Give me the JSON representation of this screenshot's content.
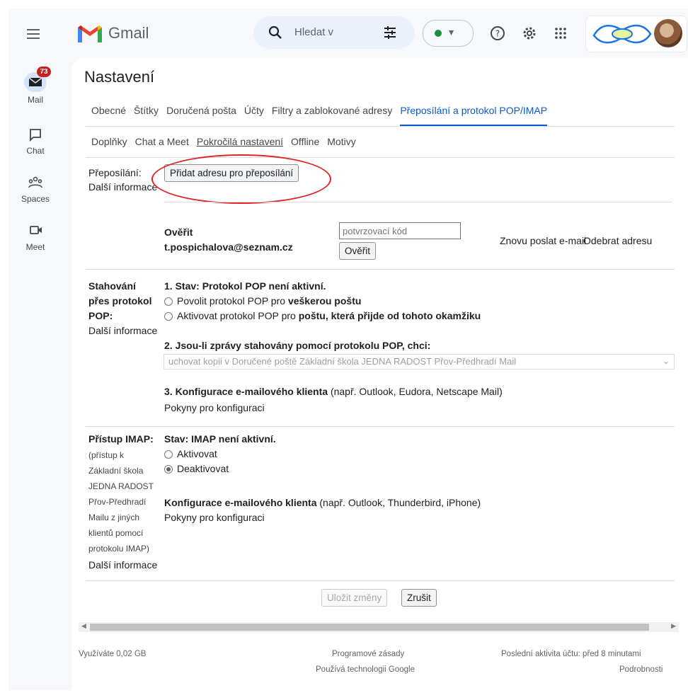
{
  "app": {
    "name": "Gmail"
  },
  "search": {
    "placeholder": "Hledat v"
  },
  "rail": {
    "mail_label": "Mail",
    "mail_badge": "73",
    "chat_label": "Chat",
    "spaces_label": "Spaces",
    "meet_label": "Meet"
  },
  "page": {
    "title": "Nastavení"
  },
  "tabs_row1": [
    "Obecné",
    "Štítky",
    "Doručená pošta",
    "Účty",
    "Filtry a zablokované adresy",
    "Přeposílání a protokol POP/IMAP"
  ],
  "tabs_row2": [
    "Doplňky",
    "Chat a Meet",
    "Pokročilá nastavení",
    "Offline",
    "Motivy"
  ],
  "forwarding": {
    "label": "Přeposílání:",
    "more_info": "Další informace",
    "add_button": "Přidat adresu pro přeposílání",
    "verify_label": "Ověřit",
    "verify_email": "t.pospichalova@seznam.cz",
    "code_placeholder": "potvrzovací kód",
    "verify_button": "Ověřit",
    "resend_link": "Znovu poslat e-mail",
    "remove_link": "Odebrat adresu"
  },
  "pop": {
    "label_line1": "Stahování",
    "label_line2": "přes protokol",
    "label_line3": "POP:",
    "more_info": "Další informace",
    "status": "1. Stav: Protokol POP není aktivní.",
    "option1_pre": "Povolit protokol POP pro ",
    "option1_bold": "veškerou poštu",
    "option2_pre": "Aktivovat protokol POP pro ",
    "option2_bold": "poštu, která přijde od tohoto okamžiku",
    "when_heading": "2. Jsou-li zprávy stahovány pomocí protokolu POP, chci:",
    "when_select": "uchovat kopii v Doručené poště Základní škola JEDNA RADOST Přov-Předhradí Mail",
    "client_heading": "3. Konfigurace e-mailového klienta",
    "client_note": " (např. Outlook, Eudora, Netscape Mail)",
    "config_link": "Pokyny pro konfiguraci"
  },
  "imap": {
    "label": "Přístup IMAP:",
    "note_lines": [
      "(přístup k",
      "Základní škola",
      "JEDNA RADOST",
      "Přov-Předhradí",
      "Mailu z jiných",
      "klientů pomocí",
      "protokolu IMAP)"
    ],
    "more_info": "Další informace",
    "status": "Stav: IMAP není aktivní.",
    "enable": "Aktivovat",
    "disable": "Deaktivovat",
    "client_heading": "Konfigurace e-mailového klienta",
    "client_note": " (např. Outlook, Thunderbird, iPhone)",
    "config_link": "Pokyny pro konfiguraci"
  },
  "actions": {
    "save": "Uložit změny",
    "cancel": "Zrušit"
  },
  "footer": {
    "usage": "Využíváte 0,02 GB",
    "policies": "Programové zásady",
    "powered": "Používá technologii Google",
    "last_activity": "Poslední aktivita účtu: před 8 minutami",
    "details": "Podrobnosti"
  },
  "colors": {
    "accent": "#0b57d0",
    "highlight_circle": "#e02424",
    "badge": "#c5221f",
    "status_green": "#1e8e3e"
  },
  "icons": [
    "menu-icon",
    "gmail-logo",
    "search-icon",
    "filter-icon",
    "status-dot-icon",
    "help-icon",
    "gear-icon",
    "apps-grid-icon",
    "mail-icon",
    "chat-icon",
    "spaces-icon",
    "meet-icon"
  ]
}
